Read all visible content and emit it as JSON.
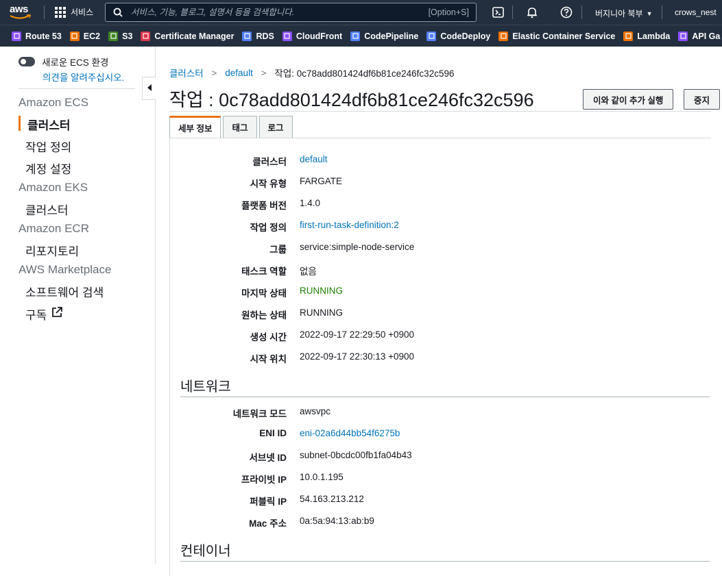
{
  "topnav": {
    "logo_text": "aws",
    "services_label": "서비스",
    "search_placeholder": "서비스, 기능, 블로그, 설명서 등을 검색합니다.",
    "search_shortcut": "[Option+S]",
    "region": "버지니아 북부",
    "account": "crows_nest"
  },
  "favorites": [
    {
      "label": "Route 53",
      "color": "#8c4fff"
    },
    {
      "label": "EC2",
      "color": "#ed7100"
    },
    {
      "label": "S3",
      "color": "#3f8624"
    },
    {
      "label": "Certificate Manager",
      "color": "#dd344c"
    },
    {
      "label": "RDS",
      "color": "#527fff"
    },
    {
      "label": "CloudFront",
      "color": "#8c4fff"
    },
    {
      "label": "CodePipeline",
      "color": "#527fff"
    },
    {
      "label": "CodeDeploy",
      "color": "#527fff"
    },
    {
      "label": "Elastic Container Service",
      "color": "#ed7100"
    },
    {
      "label": "Lambda",
      "color": "#ed7100"
    },
    {
      "label": "API Ga",
      "color": "#8c4fff"
    }
  ],
  "sidebar": {
    "toggle_label": "새로운 ECS 환경",
    "feedback": "의견을 알려주십시오.",
    "sections": [
      {
        "title": "Amazon ECS",
        "items": [
          "클러스터",
          "작업 정의",
          "계정 설정"
        ]
      },
      {
        "title": "Amazon EKS",
        "items": [
          "클러스터"
        ]
      },
      {
        "title": "Amazon ECR",
        "items": [
          "리포지토리"
        ]
      },
      {
        "title": "AWS Marketplace",
        "items": [
          "소프트웨어 검색",
          "구독"
        ]
      }
    ]
  },
  "breadcrumb": {
    "items": [
      "클러스터",
      "default"
    ],
    "current": "작업: 0c78add801424df6b81ce246fc32c596"
  },
  "page": {
    "title": "작업 : 0c78add801424df6b81ce246fc32c596",
    "run_more_button": "이와 같이 추가 실행",
    "stop_button": "중지"
  },
  "tabs": [
    "세부 정보",
    "태그",
    "로그"
  ],
  "details": [
    {
      "label": "클러스터",
      "value": "default",
      "style": "link"
    },
    {
      "label": "시작 유형",
      "value": "FARGATE",
      "style": ""
    },
    {
      "label": "플랫폼 버전",
      "value": "1.4.0",
      "style": ""
    },
    {
      "label": "작업 정의",
      "value": "first-run-task-definition:2",
      "style": "link"
    },
    {
      "label": "그룹",
      "value": "service:simple-node-service",
      "style": ""
    },
    {
      "label": "태스크 역할",
      "value": "없음",
      "style": ""
    },
    {
      "label": "마지막 상태",
      "value": "RUNNING",
      "style": "green"
    },
    {
      "label": "원하는 상태",
      "value": "RUNNING",
      "style": ""
    },
    {
      "label": "생성 시간",
      "value": "2022-09-17 22:29:50 +0900",
      "style": ""
    },
    {
      "label": "시작 위치",
      "value": "2022-09-17 22:30:13 +0900",
      "style": ""
    }
  ],
  "network": {
    "title": "네트워크",
    "rows": [
      {
        "label": "네트워크 모드",
        "value": "awsvpc",
        "style": ""
      },
      {
        "label": "ENI ID",
        "value": "eni-02a6d44bb54f6275b",
        "style": "link"
      },
      {
        "label": "서브넷 ID",
        "value": "subnet-0bcdc00fb1fa04b43",
        "style": ""
      },
      {
        "label": "프라이빗 IP",
        "value": "10.0.1.195",
        "style": ""
      },
      {
        "label": "퍼블릭 IP",
        "value": "54.163.213.212",
        "style": ""
      },
      {
        "label": "Mac 주소",
        "value": "0a:5a:94:13:ab:b9",
        "style": ""
      }
    ]
  },
  "containers": {
    "title": "컨테이너"
  }
}
